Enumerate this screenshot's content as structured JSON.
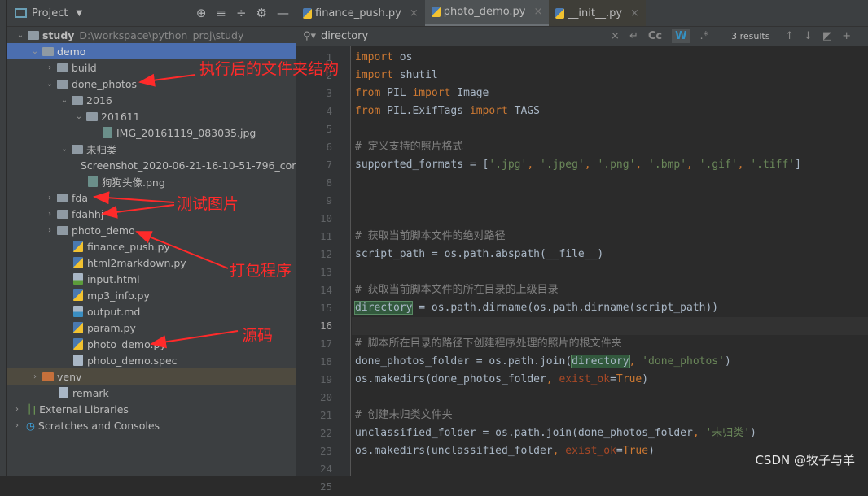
{
  "project": {
    "title": "Project",
    "tools": [
      "locate-icon",
      "expand-icon",
      "collapse-icon",
      "gear-icon",
      "minimize-icon"
    ]
  },
  "tree": [
    {
      "label": "study",
      "path": "D:\\workspace\\python_proj\\study",
      "level": 0,
      "type": "folder",
      "open": true
    },
    {
      "label": "demo",
      "level": 1,
      "type": "folder",
      "open": true,
      "selected": true
    },
    {
      "label": "build",
      "level": 2,
      "type": "folder",
      "open": false
    },
    {
      "label": "done_photos",
      "level": 2,
      "type": "folder",
      "open": true
    },
    {
      "label": "2016",
      "level": 3,
      "type": "folder",
      "open": true
    },
    {
      "label": "201611",
      "level": 4,
      "type": "folder",
      "open": true
    },
    {
      "label": "IMG_20161119_083035.jpg",
      "level": 5,
      "type": "img"
    },
    {
      "label": "未归类",
      "level": 3,
      "type": "folder",
      "open": true
    },
    {
      "label": "Screenshot_2020-06-21-16-10-51-796_com",
      "level": 4,
      "type": "img"
    },
    {
      "label": "狗狗头像.png",
      "level": 4,
      "type": "img"
    },
    {
      "label": "fda",
      "level": 2,
      "type": "folder",
      "open": false
    },
    {
      "label": "fdahhj",
      "level": 2,
      "type": "folder",
      "open": false
    },
    {
      "label": "photo_demo",
      "level": 2,
      "type": "folder",
      "open": false
    },
    {
      "label": "finance_push.py",
      "level": 3,
      "type": "py"
    },
    {
      "label": "html2markdown.py",
      "level": 3,
      "type": "py"
    },
    {
      "label": "input.html",
      "level": 3,
      "type": "html"
    },
    {
      "label": "mp3_info.py",
      "level": 3,
      "type": "py"
    },
    {
      "label": "output.md",
      "level": 3,
      "type": "md"
    },
    {
      "label": "param.py",
      "level": 3,
      "type": "py"
    },
    {
      "label": "photo_demo.py",
      "level": 3,
      "type": "py"
    },
    {
      "label": "photo_demo.spec",
      "level": 3,
      "type": "text"
    },
    {
      "label": "venv",
      "level": 1,
      "type": "folder-excluded",
      "open": false
    },
    {
      "label": "remark",
      "level": 2,
      "type": "text"
    },
    {
      "label": "External Libraries",
      "level": 0,
      "type": "lib",
      "open": false
    },
    {
      "label": "Scratches and Consoles",
      "level": 0,
      "type": "scratch",
      "open": false
    }
  ],
  "tabs": [
    {
      "label": "finance_push.py"
    },
    {
      "label": "photo_demo.py",
      "active": true
    },
    {
      "label": "__init__.py"
    }
  ],
  "find": {
    "query": "directory",
    "results": "3 results",
    "case_label": "Cc",
    "word_label": "W",
    "regex_label": ".*"
  },
  "current_line": 16,
  "code": [
    [
      [
        "import",
        "kw"
      ],
      [
        " os",
        ""
      ]
    ],
    [
      [
        "import",
        "kw"
      ],
      [
        " shutil",
        ""
      ]
    ],
    [
      [
        "from",
        "kw"
      ],
      [
        " PIL ",
        ""
      ],
      [
        "import",
        "kw"
      ],
      [
        " Image",
        ""
      ]
    ],
    [
      [
        "from",
        "kw"
      ],
      [
        " PIL.ExifTags ",
        ""
      ],
      [
        "import",
        "kw"
      ],
      [
        " TAGS",
        ""
      ]
    ],
    [],
    [
      [
        "# 定义支持的照片格式",
        "cm"
      ]
    ],
    [
      [
        "supported_formats = [",
        ""
      ],
      [
        "'.jpg'",
        "st"
      ],
      [
        ", ",
        "kw"
      ],
      [
        "'.jpeg'",
        "st"
      ],
      [
        ", ",
        "kw"
      ],
      [
        "'.png'",
        "st"
      ],
      [
        ", ",
        "kw"
      ],
      [
        "'.bmp'",
        "st"
      ],
      [
        ", ",
        "kw"
      ],
      [
        "'.gif'",
        "st"
      ],
      [
        ", ",
        "kw"
      ],
      [
        "'.tiff'",
        "st"
      ],
      [
        "]",
        ""
      ]
    ],
    [],
    [],
    [],
    [
      [
        "# 获取当前脚本文件的绝对路径",
        "cm"
      ]
    ],
    [
      [
        "script_path = os.path.abspath(__file__)",
        ""
      ]
    ],
    [],
    [
      [
        "# 获取当前脚本文件的所在目录的上级目录",
        "cm"
      ]
    ],
    [
      [
        "directory",
        "hl"
      ],
      [
        " = os.path.dirname(os.path.dirname(script_path))",
        ""
      ]
    ],
    [],
    [
      [
        "# 脚本所在目录的路径下创建程序处理的照片的根文件夹",
        "cm"
      ]
    ],
    [
      [
        "done_photos_folder = os.path.join(",
        ""
      ],
      [
        "directory",
        "hl"
      ],
      [
        ", ",
        "kw"
      ],
      [
        "'done_photos'",
        "st"
      ],
      [
        ")",
        ""
      ]
    ],
    [
      [
        "os.makedirs(done_photos_folder",
        ""
      ],
      [
        ", ",
        "kw"
      ],
      [
        "exist_ok",
        "pa"
      ],
      [
        "=",
        ""
      ],
      [
        "True",
        "kw"
      ],
      [
        ")",
        ""
      ]
    ],
    [],
    [
      [
        "# 创建未归类文件夹",
        "cm"
      ]
    ],
    [
      [
        "unclassified_folder = os.path.join(done_photos_folder",
        ""
      ],
      [
        ", ",
        "kw"
      ],
      [
        "'未归类'",
        "st"
      ],
      [
        ")",
        ""
      ]
    ],
    [
      [
        "os.makedirs(unclassified_folder",
        ""
      ],
      [
        ", ",
        "kw"
      ],
      [
        "exist_ok",
        "pa"
      ],
      [
        "=",
        ""
      ],
      [
        "True",
        "kw"
      ],
      [
        ")",
        ""
      ]
    ],
    [],
    []
  ],
  "annotations": [
    "执行后的文件夹结构",
    "测试图片",
    "打包程序",
    "源码"
  ],
  "watermark": "CSDN @牧子与羊",
  "colors": {
    "selection": "#4b6eaf",
    "annotation": "#ff2a2a",
    "keyword": "#cc7832",
    "string": "#6a8759",
    "comment": "#808080"
  }
}
